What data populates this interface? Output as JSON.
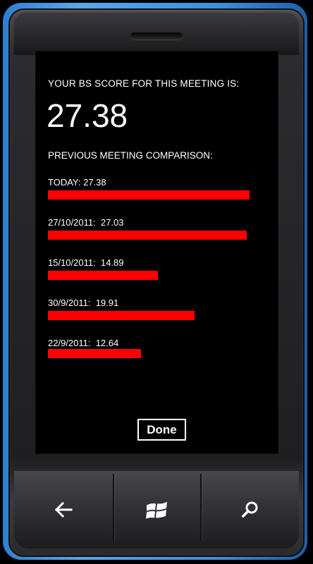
{
  "header": {
    "score_title": "YOUR BS SCORE FOR THIS MEETING IS:",
    "score_value": "27.38"
  },
  "comparison": {
    "title": "PREVIOUS MEETING COMPARISON:",
    "entries": [
      {
        "label": "TODAY: 27.38",
        "value": 27.38
      },
      {
        "label": "27/10/2011:  27.03",
        "value": 27.03
      },
      {
        "label": "15/10/2011:  14.89",
        "value": 14.89
      },
      {
        "label": "30/9/2011:  19.91",
        "value": 19.91
      },
      {
        "label": "22/9/2011:  12.64",
        "value": 12.64
      }
    ]
  },
  "actions": {
    "done_label": "Done"
  },
  "hardware_buttons": {
    "back": "back-arrow-icon",
    "start": "windows-logo-icon",
    "search": "search-icon"
  },
  "colors": {
    "bar": "#ff0000",
    "accent_frame": "#3d8fdc"
  }
}
